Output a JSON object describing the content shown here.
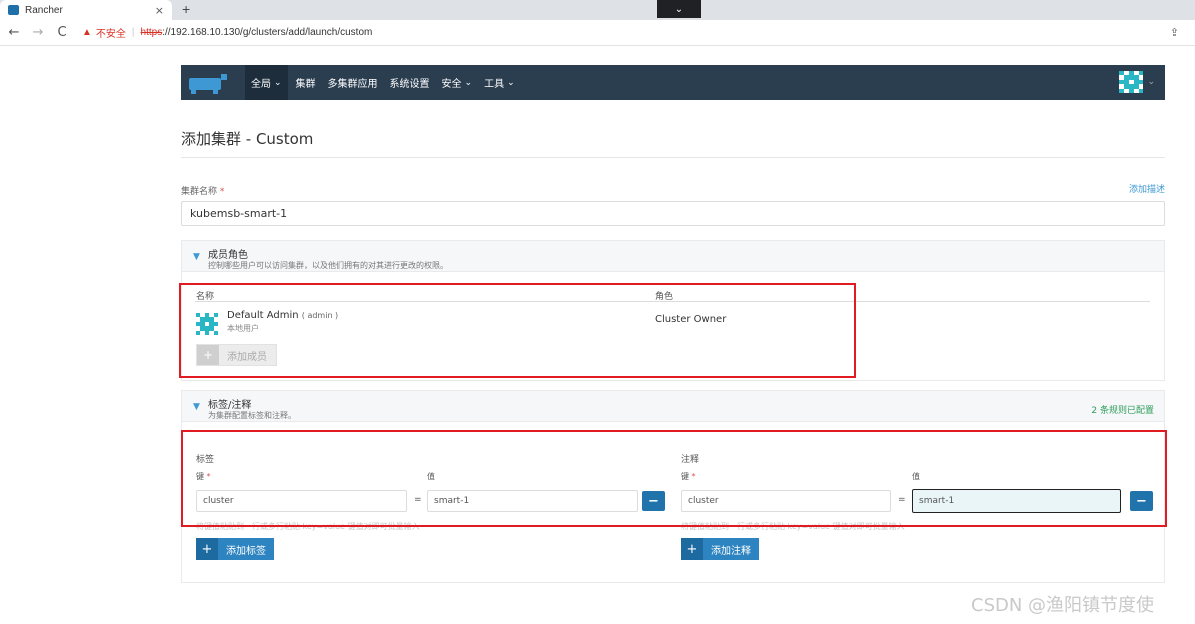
{
  "browser": {
    "tab_title": "Rancher",
    "tab_close": "×",
    "new_tab": "+",
    "tab_search": "⌄",
    "back": "←",
    "forward": "→",
    "reload": "C",
    "warning_icon": "▲",
    "insecure_label": "不安全",
    "separator": "|",
    "url_scheme": "https",
    "url_rest": "://192.168.10.130/g/clusters/add/launch/custom",
    "share_icon": "⇪"
  },
  "header": {
    "nav": [
      {
        "label": "全局",
        "has_chevron": true
      },
      {
        "label": "集群",
        "has_chevron": false
      },
      {
        "label": "多集群应用",
        "has_chevron": false
      },
      {
        "label": "系统设置",
        "has_chevron": false
      },
      {
        "label": "安全",
        "has_chevron": true
      },
      {
        "label": "工具",
        "has_chevron": true
      }
    ],
    "chevron": "⌄",
    "bg_color": "#2b3e50"
  },
  "page": {
    "title": "添加集群 - Custom",
    "cluster_name_label": "集群名称",
    "required_mark": "*",
    "add_description": "添加描述",
    "cluster_name_value": "kubemsb-smart-1"
  },
  "members": {
    "title": "成员角色",
    "subtitle": "控制哪些用户可以访问集群，以及他们拥有的对其进行更改的权限。",
    "triangle": "▼",
    "col_name": "名称",
    "col_role": "角色",
    "rows": [
      {
        "name": "Default Admin",
        "login": "( admin )",
        "sub": "本地用户",
        "role": "Cluster Owner"
      }
    ],
    "add_button": "添加成员",
    "plus": "+"
  },
  "labels": {
    "title": "标签/注释",
    "subtitle": "为集群配置标签和注释。",
    "status": "2 条规则已配置",
    "labels_heading": "标签",
    "annotations_heading": "注释",
    "key_label": "键",
    "value_label": "值",
    "equals": "=",
    "minus": "−",
    "label_key": "cluster",
    "label_value": "smart-1",
    "annotation_key": "cluster",
    "annotation_value": "smart-1",
    "label_hint": "将键值粘贴到一行或多行粘贴 key=value 键值对即可批量输入",
    "annotation_hint": "将键值粘贴到一行或多行粘贴 key=value 键值对即可批量输入",
    "add_label": "添加标签",
    "add_annotation": "添加注释",
    "plus": "+"
  },
  "watermark": "CSDN @渔阳镇节度使",
  "colors": {
    "accent": "#3d98d3",
    "button_blue": "#2173ab",
    "highlight_red": "#e11b22",
    "status_green": "#2e9d5c"
  }
}
